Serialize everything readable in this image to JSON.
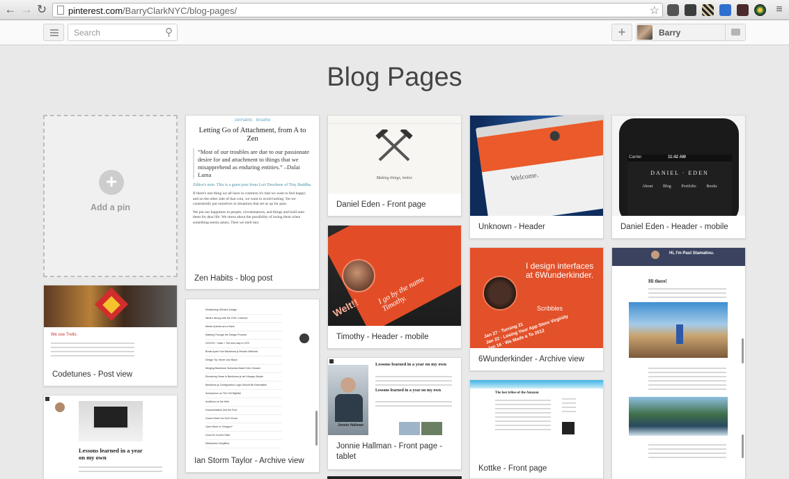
{
  "browser": {
    "url_host": "pinterest.com",
    "url_path": "/BarryClarkNYC/blog-pages/"
  },
  "header": {
    "search_placeholder": "Search",
    "user_name": "Barry"
  },
  "board": {
    "title": "Blog Pages",
    "add_pin_label": "Add a pin"
  },
  "pins": {
    "zen": {
      "caption": "Zen Habits - blog post",
      "site_tag": "zenhabits · breathe",
      "headline": "Letting Go of Attachment, from A to Zen",
      "quote": "“Most of our troubles are due to our passionate desire for and attachment to things that we misapprehend as enduring entities.” –Dalai Lama",
      "editor_note": "Editor's note: This is a guest post from Lori Deschene of Tiny Buddha.",
      "para1": "If there's one thing we all have in common it's that we want to feel happy; and on the other side of that coin, we want to avoid hurting. Yet we consistently put ourselves in situations that set us up for pain.",
      "para2": "We pin our happiness to people, circumstances, and things and hold onto them for dear life. We stress about the possibility of losing them when something seems amiss. Then we melt into"
    },
    "daniel_front": {
      "caption": "Daniel Eden - Front page",
      "tagline": "Making things, better."
    },
    "unknown_header": {
      "caption": "Unknown - Header",
      "welcome": "Welcome."
    },
    "daniel_mobile": {
      "caption": "Daniel Eden - Header - mobile",
      "carrier": "Carrier",
      "time": "11:42 AM",
      "brand": "DANIEL · EDEN",
      "nav": [
        "About",
        "Blog",
        "Portfolio",
        "Books"
      ]
    },
    "codetunes": {
      "caption": "Codetunes - Post view",
      "heading": "We use Trello."
    },
    "ian_storm": {
      "caption": "Ian Storm Taylor - Archive view",
      "items": [
        "Refactoring GitHub's Design",
        "What's Wrong with the CSS I Learned",
        "Media Queries are a Hack",
        "Walking Through the Design Process",
        "OOCSS + Sass = The best way to CSS",
        "Break Apart Your Backbone.js Render Methods",
        "Design Tip: Never Use Black",
        "Merging Backbone Subviews Made Even Cleaner",
        "Rendering Views in Backbone.js Isn't Always Simple",
        "Backbone.js Configuration Logic Should Be Extendable",
        "Anonymous on The Old Nightlar",
        "Auditions on the Web",
        "Documentation and the Pool",
        "Guess What You Don't Know",
        "Open Work or Shotgun?",
        "Good for Good's Sake",
        "Webkinetic Simplified"
      ]
    },
    "timothy_mobile": {
      "caption": "Timothy - Header - mobile",
      "text": "I go by the name Timothy.",
      "welt": "Welt!!"
    },
    "wunderkinder": {
      "caption": "6Wunderkinder - Archive view",
      "headline": "I design interfaces at 6Wunderkinder.",
      "scribbles": "Scribbles",
      "items": [
        "Jan 27 · Turning 21",
        "Jan 22 · Losing Your App Store Virginity",
        "Jan 16 · We Made a To 2012"
      ]
    },
    "jonnie": {
      "caption": "Jonnie Hallman - Front page - tablet",
      "headline": "Lessons learned in a year on my own",
      "name": "Jonnie Hallman"
    },
    "kottke": {
      "caption": "Kottke - Front page",
      "headline": "The last tribes of the Amazon"
    },
    "paul": {
      "header": "Hi, I'm Paul Stamatiou.",
      "greeting": "Hi there!"
    },
    "lessons_small": {
      "headline": "Lessons learned in a year on my own"
    }
  },
  "colors": {
    "accent_orange": "#e2512a",
    "pin_bg": "#ffffff",
    "page_bg": "#e9e9e9"
  }
}
